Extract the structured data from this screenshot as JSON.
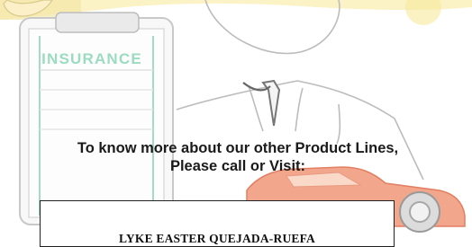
{
  "clipboard": {
    "label": "INSURANCE"
  },
  "promo": {
    "line1": "To know more about our other Product Lines,",
    "line2": "Please call or Visit:"
  },
  "contact": {
    "name": "LYKE EASTER QUEJADA-RUEFA"
  },
  "colors": {
    "accent_yellow": "#f6e27a",
    "clipboard_green": "#8fd3b5",
    "car_orange": "#ef9a7e",
    "line_gray": "#9a9a9a"
  }
}
